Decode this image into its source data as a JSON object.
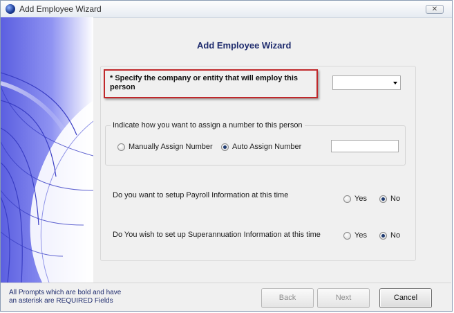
{
  "window": {
    "title": "Add Employee Wizard",
    "close_glyph": "✕"
  },
  "heading": "Add Employee Wizard",
  "company": {
    "prompt": "* Specify the company or entity that will employ this person",
    "selected_value": ""
  },
  "numbering": {
    "legend": "Indicate how you want to assign a number to this person",
    "manual_label": "Manually Assign Number",
    "auto_label": "Auto Assign Number",
    "selected": "auto",
    "number_value": ""
  },
  "payroll": {
    "question": "Do you want to setup Payroll Information at this time",
    "yes_label": "Yes",
    "no_label": "No",
    "selected": "no"
  },
  "super": {
    "question": "Do You wish to set up Superannuation Information at this time",
    "yes_label": "Yes",
    "no_label": "No",
    "selected": "no"
  },
  "footer": {
    "note_line1": "All Prompts which are bold and have",
    "note_line2": "an asterisk are REQUIRED Fields",
    "back_label": "Back",
    "next_label": "Next",
    "cancel_label": "Cancel"
  },
  "colors": {
    "heading": "#1f2c6e",
    "highlight_border": "#c0282b",
    "side_panel": "#6a6ee8"
  }
}
